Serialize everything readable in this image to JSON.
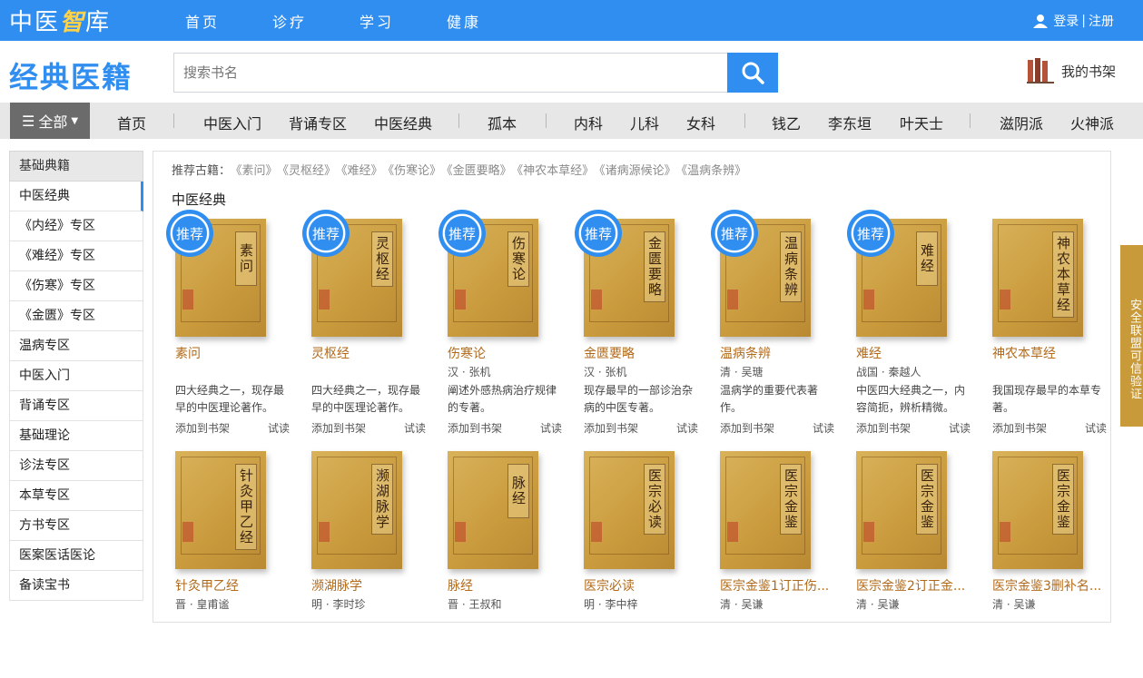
{
  "top": {
    "logo_a": "中医",
    "logo_b": "智",
    "logo_c": "库",
    "nav": [
      "首页",
      "诊疗",
      "学习",
      "健康"
    ],
    "login": "登录",
    "register": "注册"
  },
  "header": {
    "brand": "经典医籍",
    "search_placeholder": "搜索书名",
    "shelf": "我的书架"
  },
  "catbar": {
    "all": "全部",
    "items": [
      "首页",
      "中医入门",
      "背诵专区",
      "中医经典",
      "孤本",
      "内科",
      "儿科",
      "女科",
      "钱乙",
      "李东垣",
      "叶天士",
      "滋阴派",
      "火神派"
    ]
  },
  "sidebar": {
    "head": "基础典籍",
    "items": [
      "中医经典",
      "《内经》专区",
      "《难经》专区",
      "《伤寒》专区",
      "《金匮》专区",
      "温病专区",
      "中医入门",
      "背诵专区",
      "基础理论",
      "诊法专区",
      "本草专区",
      "方书专区",
      "医案医话医论",
      "备读宝书"
    ]
  },
  "main": {
    "rec_label": "推荐古籍：",
    "rec_books": [
      "《素问》",
      "《灵枢经》",
      "《难经》",
      "《伤寒论》",
      "《金匮要略》",
      "《神农本草经》",
      "《诸病源候论》",
      "《温病条辨》"
    ],
    "section_title": "中医经典",
    "badge": "推荐",
    "add": "添加到书架",
    "try": "试读",
    "books": [
      {
        "name": "素问",
        "cover": "素问",
        "author": "",
        "desc": "四大经典之一，现存最早的中医理论著作。",
        "rec": true
      },
      {
        "name": "灵枢经",
        "cover": "灵枢经",
        "author": "",
        "desc": "四大经典之一，现存最早的中医理论著作。",
        "rec": true
      },
      {
        "name": "伤寒论",
        "cover": "伤寒论",
        "author": "汉 · 张机",
        "desc": "阐述外感热病治疗规律的专著。",
        "rec": true
      },
      {
        "name": "金匮要略",
        "cover": "金匮要略",
        "author": "汉 · 张机",
        "desc": "现存最早的一部诊治杂病的中医专著。",
        "rec": true
      },
      {
        "name": "温病条辨",
        "cover": "温病条辨",
        "author": "清 · 吴瑭",
        "desc": "温病学的重要代表著作。",
        "rec": true
      },
      {
        "name": "难经",
        "cover": "难经",
        "author": "战国 · 秦越人",
        "desc": "中医四大经典之一，内容简扼，辨析精微。",
        "rec": true
      },
      {
        "name": "神农本草经",
        "cover": "神农本草经",
        "author": "",
        "desc": "我国现存最早的本草专著。",
        "rec": false
      },
      {
        "name": "针灸甲乙经",
        "cover": "针灸甲乙经",
        "author": "晋 · 皇甫谧",
        "desc": "",
        "rec": false
      },
      {
        "name": "濒湖脉学",
        "cover": "濒湖脉学",
        "author": "明 · 李时珍",
        "desc": "",
        "rec": false
      },
      {
        "name": "脉经",
        "cover": "脉经",
        "author": "晋 · 王叔和",
        "desc": "",
        "rec": false
      },
      {
        "name": "医宗必读",
        "cover": "医宗必读",
        "author": "明 · 李中梓",
        "desc": "",
        "rec": false
      },
      {
        "name": "医宗金鉴1订正伤...",
        "cover": "医宗金鉴",
        "author": "清 · 吴谦",
        "desc": "",
        "rec": false
      },
      {
        "name": "医宗金鉴2订正金...",
        "cover": "医宗金鉴",
        "author": "清 · 吴谦",
        "desc": "",
        "rec": false
      },
      {
        "name": "医宗金鉴3删补名...",
        "cover": "医宗金鉴",
        "author": "清 · 吴谦",
        "desc": "",
        "rec": false
      }
    ]
  },
  "safety": "安全联盟可信验证"
}
